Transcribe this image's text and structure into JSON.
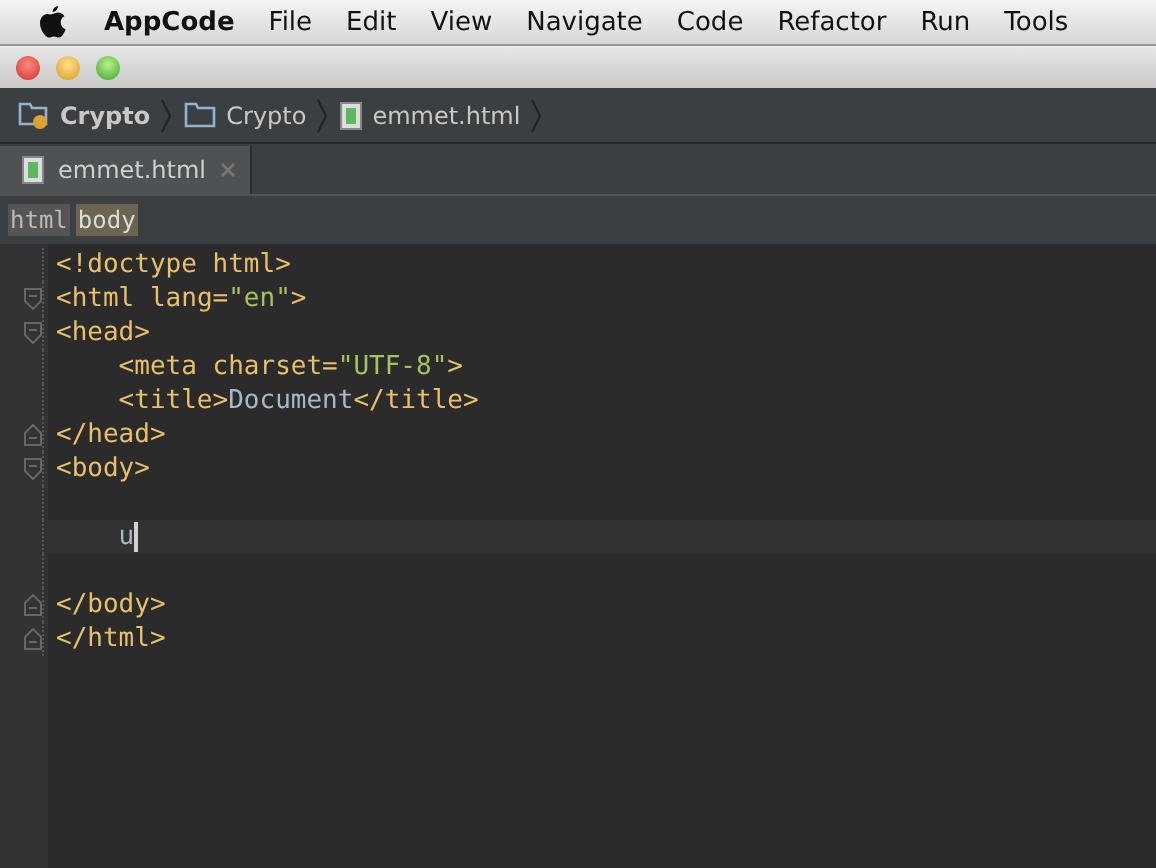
{
  "menu_bar": {
    "app_name": "AppCode",
    "items": [
      "File",
      "Edit",
      "View",
      "Navigate",
      "Code",
      "Refactor",
      "Run",
      "Tools"
    ]
  },
  "navigation_bar": [
    {
      "kind": "project",
      "label": "Crypto"
    },
    {
      "kind": "folder",
      "label": "Crypto"
    },
    {
      "kind": "file",
      "label": "emmet.html"
    }
  ],
  "tabs": [
    {
      "label": "emmet.html",
      "selected": true
    }
  ],
  "tag_path": [
    {
      "label": "html",
      "selected": false
    },
    {
      "label": "body",
      "selected": true
    }
  ],
  "editor_lines": [
    {
      "fold_open": false,
      "fold_close": false,
      "indented": false,
      "current": false,
      "tokens": [
        {
          "kind": "tag",
          "text": "<!doctype html>"
        }
      ]
    },
    {
      "fold_open": true,
      "fold_close": false,
      "indented": false,
      "current": false,
      "tokens": [
        {
          "kind": "tag",
          "text": "<html lang="
        },
        {
          "kind": "value",
          "text": "\"en\""
        },
        {
          "kind": "tag",
          "text": ">"
        }
      ]
    },
    {
      "fold_open": true,
      "fold_close": false,
      "indented": false,
      "current": false,
      "tokens": [
        {
          "kind": "tag",
          "text": "<head>"
        }
      ]
    },
    {
      "fold_open": false,
      "fold_close": false,
      "indented": true,
      "current": false,
      "tokens": [
        {
          "kind": "tag",
          "text": "<meta charset="
        },
        {
          "kind": "value",
          "text": "\"UTF-8\""
        },
        {
          "kind": "tag",
          "text": ">"
        }
      ]
    },
    {
      "fold_open": false,
      "fold_close": false,
      "indented": true,
      "current": false,
      "tokens": [
        {
          "kind": "tag",
          "text": "<title>"
        },
        {
          "kind": "text",
          "text": "Document"
        },
        {
          "kind": "tag",
          "text": "</title>"
        }
      ]
    },
    {
      "fold_open": false,
      "fold_close": true,
      "indented": false,
      "current": false,
      "tokens": [
        {
          "kind": "tag",
          "text": "</head>"
        }
      ]
    },
    {
      "fold_open": true,
      "fold_close": false,
      "indented": false,
      "current": false,
      "tokens": [
        {
          "kind": "tag",
          "text": "<body>"
        }
      ]
    },
    {
      "fold_open": false,
      "fold_close": false,
      "current": false
    },
    {
      "fold_open": false,
      "fold_close": false,
      "indented": true,
      "current": true,
      "tokens": [
        {
          "kind": "text",
          "text": "u"
        }
      ]
    },
    {
      "fold_open": false,
      "fold_close": false,
      "current": false
    },
    {
      "fold_open": false,
      "fold_close": true,
      "indented": false,
      "current": false,
      "tokens": [
        {
          "kind": "tag",
          "text": "</body>"
        }
      ]
    },
    {
      "fold_open": false,
      "fold_close": true,
      "indented": false,
      "current": false,
      "tokens": [
        {
          "kind": "tag",
          "text": "</html>"
        }
      ]
    }
  ]
}
